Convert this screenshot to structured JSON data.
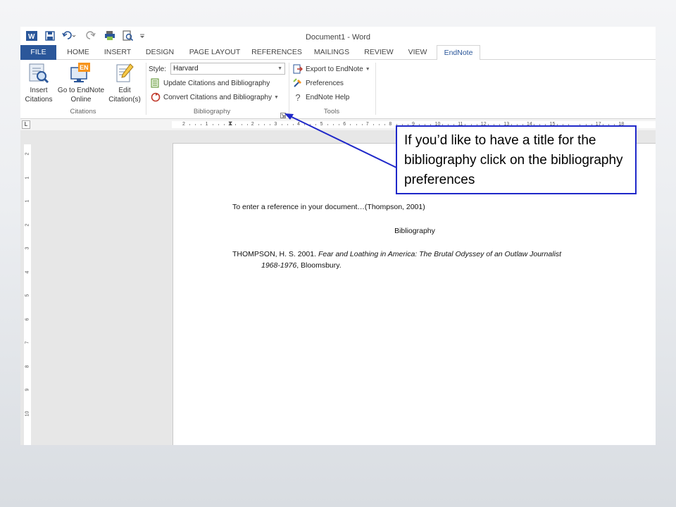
{
  "window": {
    "title": "Document1 - Word"
  },
  "quick_access": {
    "word_icon": "word-logo-icon",
    "save_icon": "save-icon",
    "undo_icon": "undo-icon",
    "redo_icon": "redo-icon",
    "print_icon": "print-icon",
    "preview_icon": "print-preview-icon",
    "customize_icon": "customize-qat-icon"
  },
  "tabs": [
    "FILE",
    "HOME",
    "INSERT",
    "DESIGN",
    "PAGE LAYOUT",
    "REFERENCES",
    "MAILINGS",
    "REVIEW",
    "VIEW",
    "EndNote"
  ],
  "ribbon": {
    "citations": {
      "insert": [
        "Insert",
        "Citations"
      ],
      "online": [
        "Go to EndNote",
        "Online"
      ],
      "edit": [
        "Edit",
        "Citation(s)"
      ],
      "label": "Citations"
    },
    "bibliography": {
      "style_label": "Style:",
      "style_value": "Harvard",
      "update": "Update Citations and Bibliography",
      "convert": "Convert Citations and Bibliography",
      "label": "Bibliography"
    },
    "tools": {
      "export": "Export to EndNote",
      "preferences": "Preferences",
      "help": "EndNote Help",
      "label": "Tools"
    }
  },
  "ruler": {
    "h_labels": [
      "2",
      "1",
      "1",
      "2",
      "3",
      "4",
      "5",
      "6",
      "7",
      "8",
      "9",
      "10",
      "11",
      "12",
      "13",
      "14",
      "15",
      "17",
      "18"
    ],
    "v_labels": [
      "2",
      "1",
      "1",
      "2",
      "3",
      "4",
      "5",
      "6",
      "7",
      "8",
      "9",
      "10"
    ]
  },
  "document": {
    "line1": "To enter a reference in your document…(Thompson, 2001)",
    "heading": "Bibliography",
    "ref_prefix": "THOMPSON, H. S. 2001. ",
    "ref_title_1": "Fear and Loathing in America: The Brutal Odyssey of an Outlaw Journalist",
    "ref_title_2": "1968-1976",
    "ref_suffix": ", Bloomsbury."
  },
  "callout": {
    "text": "If you’d like to have a title for the bibliography  click on the bibliography  preferences"
  },
  "colors": {
    "accent": "#2b579a",
    "callout_border": "#1f28c9"
  }
}
